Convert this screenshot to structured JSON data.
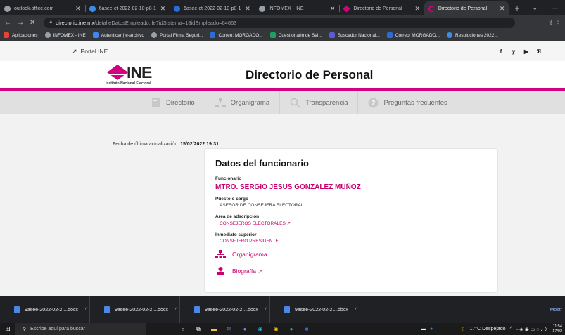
{
  "browser": {
    "tabs": [
      {
        "label": "outlook.office.com",
        "color": "#9aa0a6",
        "active": false
      },
      {
        "label": "6asee-ct-2022-02-10-p8-1",
        "color": "#3a8ee6",
        "active": false
      },
      {
        "label": "6asee-ct-2022-02-10-p8-1",
        "color": "#2b6cd6",
        "active": false
      },
      {
        "label": "INFOMEX - INE",
        "color": "#9aa0a6",
        "active": false
      },
      {
        "label": "Directorio de Personal",
        "color": "#d5007f",
        "active": false
      },
      {
        "label": "Directorio de Personal",
        "color": "#d5007f",
        "active": true
      }
    ],
    "new_tab": "+",
    "window_controls": [
      "⌄",
      "—"
    ],
    "url_host": "directorio.ine.mx",
    "url_path": "/detalleDatosEmpleado.ife?idSistema=18idEmpleado=64663",
    "bookmarks": [
      {
        "label": "Aplicaciones",
        "color": "#e94235"
      },
      {
        "label": "INFOMEX - INE",
        "color": "#9aa0a6"
      },
      {
        "label": "Autenticar | e-archivo",
        "color": "#4285f4"
      },
      {
        "label": "Portal Firma Seguri...",
        "color": "#9aa0a6"
      },
      {
        "label": "Correo: MORGADO...",
        "color": "#2b6cd6"
      },
      {
        "label": "Cuestionario de Sal...",
        "color": "#1aa260"
      },
      {
        "label": "Buscador Nacional...",
        "color": "#5b5bd6"
      },
      {
        "label": "Correo: MORGADO...",
        "color": "#2b6cd6"
      },
      {
        "label": "Resoluciones 2022...",
        "color": "#3a8ee6"
      }
    ]
  },
  "page": {
    "portal_link": "Portal INE",
    "social": [
      "f",
      "y",
      "▶",
      "ℜ"
    ],
    "logo_text": "INE",
    "logo_subtitle": "Instituto Nacional Electoral",
    "title": "Directorio de Personal",
    "menu": [
      {
        "label": "Directorio",
        "icon": "directory-icon"
      },
      {
        "label": "Organigrama",
        "icon": "org-chart-icon"
      },
      {
        "label": "Transparencia",
        "icon": "magnifier-icon"
      },
      {
        "label": "Preguntas frecuentes",
        "icon": "question-icon"
      }
    ],
    "updated_label": "Fecha de última actualización:",
    "updated_value": "15/02/2022 19:31",
    "card": {
      "title": "Datos del funcionario",
      "funcionario_label": "Funcionario",
      "funcionario_value": "MTRO. SERGIO JESUS GONZALEZ MUÑOZ",
      "puesto_label": "Puesto o cargo",
      "puesto_value": "ASESOR DE CONSEJERA ELECTORAL",
      "area_label": "Área de adscripción",
      "area_value": "CONSEJEROS ELECTORALES",
      "jefe_label": "Inmediato superior",
      "jefe_value": "CONSEJERO PRESIDENTE",
      "organigrama_link": "Organigrama",
      "biografia_link": "Biografía"
    }
  },
  "downloads": {
    "items": [
      "9asee-2022-02-2....docx",
      "9asee-2022-02-2....docx",
      "9asee-2022-02-2....docx",
      "9asee-2022-02-2....docx"
    ],
    "show_all": "Mostr"
  },
  "taskbar": {
    "search_placeholder": "Escribe aquí para buscar",
    "weather": "17°C Despejado",
    "time": "11:54",
    "date": "17/02"
  },
  "colors": {
    "brand_pink": "#d5007f"
  }
}
